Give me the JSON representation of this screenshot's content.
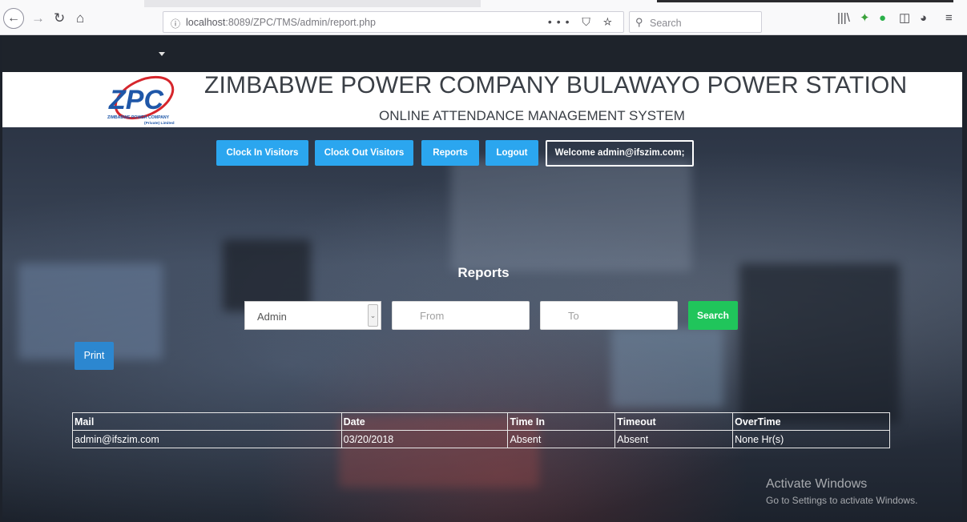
{
  "browser": {
    "url_host": "localhost",
    "url_path": ":8089/ZPC/TMS/admin/report.php",
    "search_placeholder": "Search",
    "url_actions": "••• ⛉ ☆"
  },
  "header": {
    "title": "ZIMBABWE POWER COMPANY BULAWAYO POWER STATION",
    "subtitle": "ONLINE ATTENDANCE MANAGEMENT SYSTEM",
    "logo_text": "ZPC",
    "logo_caption": "ZIMBABWE POWER COMPANY",
    "logo_caption2": "(Private) Limited"
  },
  "nav": {
    "clock_in": "Clock In Visitors",
    "clock_out": "Clock Out Visitors",
    "reports": "Reports",
    "logout": "Logout",
    "welcome": "Welcome admin@ifszim.com;"
  },
  "reports": {
    "heading": "Reports",
    "select_value": "Admin",
    "from_placeholder": "From",
    "to_placeholder": "To",
    "search_label": "Search",
    "print_label": "Print"
  },
  "table": {
    "headers": [
      "Mail",
      "Date",
      "Time In",
      "Timeout",
      "OverTime"
    ],
    "rows": [
      [
        "admin@ifszim.com",
        "03/20/2018",
        "Absent",
        "Absent",
        "None Hr(s)"
      ]
    ]
  },
  "watermark": {
    "title": "Activate Windows",
    "subtitle": "Go to Settings to activate Windows."
  },
  "colors": {
    "primary_button": "#2ba6ef",
    "search_button": "#20c55b",
    "print_button": "#2c87d0",
    "navbar": "#1e232b",
    "logo_blue": "#1f57a8",
    "logo_red": "#d6262c"
  }
}
